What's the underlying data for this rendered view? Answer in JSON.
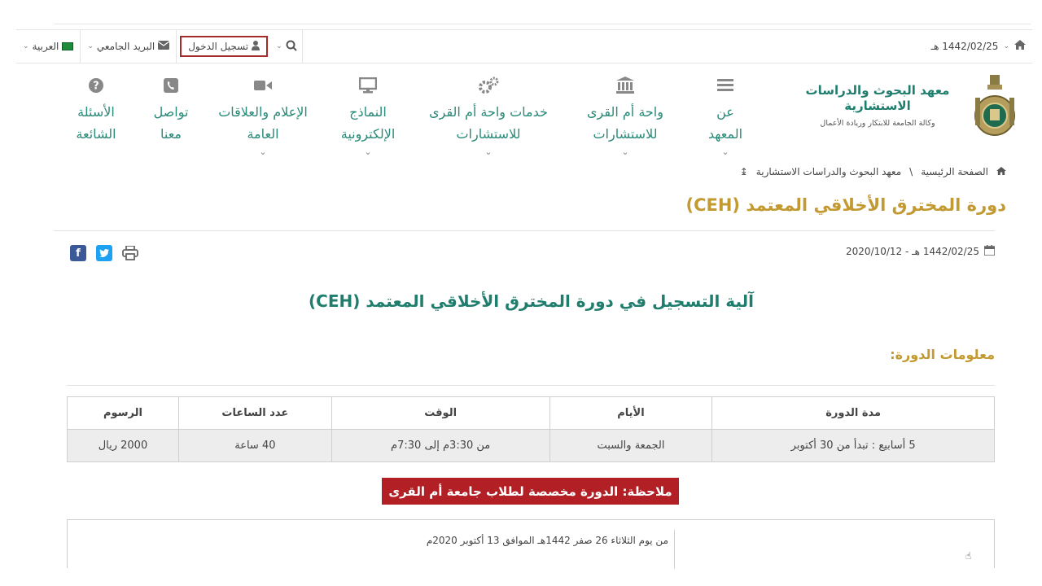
{
  "topbar": {
    "date": "1442/02/25 هـ",
    "login_label": "تسجيل الدخول",
    "mail_label": "البريد الجامعي",
    "language_label": "العربية"
  },
  "logo": {
    "title": "معهد البحوث والدراسات الاستشارية",
    "subtitle": "وكالة الجامعة للابتكار وريادة الأعمال"
  },
  "nav": {
    "items": [
      {
        "label": "عن المعهد",
        "icon": "list-icon"
      },
      {
        "label": "واحة أم القرى للاستشارات",
        "icon": "institution-icon"
      },
      {
        "label": "خدمات واحة أم القرى للاستشارات",
        "icon": "gears-icon"
      },
      {
        "label": "النماذج الإلكترونية",
        "icon": "monitor-icon"
      },
      {
        "label": "الإعلام والعلاقات العامة",
        "icon": "video-camera-icon"
      },
      {
        "label": "تواصل معنا",
        "icon": "phone-icon"
      },
      {
        "label": "الأسئلة الشائعة",
        "icon": "question-icon"
      }
    ]
  },
  "breadcrumb": {
    "home": "الصفحة الرئيسية",
    "separator": "\\",
    "current": "معهد البحوث والدراسات الاستشارية"
  },
  "page": {
    "title": "دورة المخترق الأخلاقي المعتمد (CEH)",
    "date": "1442/02/25 هـ - 2020/10/12",
    "heading": "آلية التسجيل في دورة المخترق الأخلاقي المعتمد (CEH)",
    "section_label": "معلومات الدورة:",
    "note": "ملاحظة: الدورة مخصصة لطلاب جامعة أم القرى",
    "detail_text": "من يوم الثلاثاء 26 صفر 1442هـ الموافق  13 أكتوبر 2020م"
  },
  "table": {
    "headers": [
      "مدة الدورة",
      "الأيام",
      "الوقت",
      "عدد الساعات",
      "الرسوم"
    ],
    "row": [
      "5 أسابيع : تبدأ من 30 أكتوبر",
      "الجمعة والسبت",
      "من 3:30م إلى 7:30م",
      "40 ساعة",
      "2000 ريال"
    ]
  },
  "colors": {
    "teal": "#2a8a79",
    "gold": "#c39a31",
    "note_red": "#b21f24",
    "facebook": "#3b5998",
    "twitter": "#1da1f2"
  }
}
